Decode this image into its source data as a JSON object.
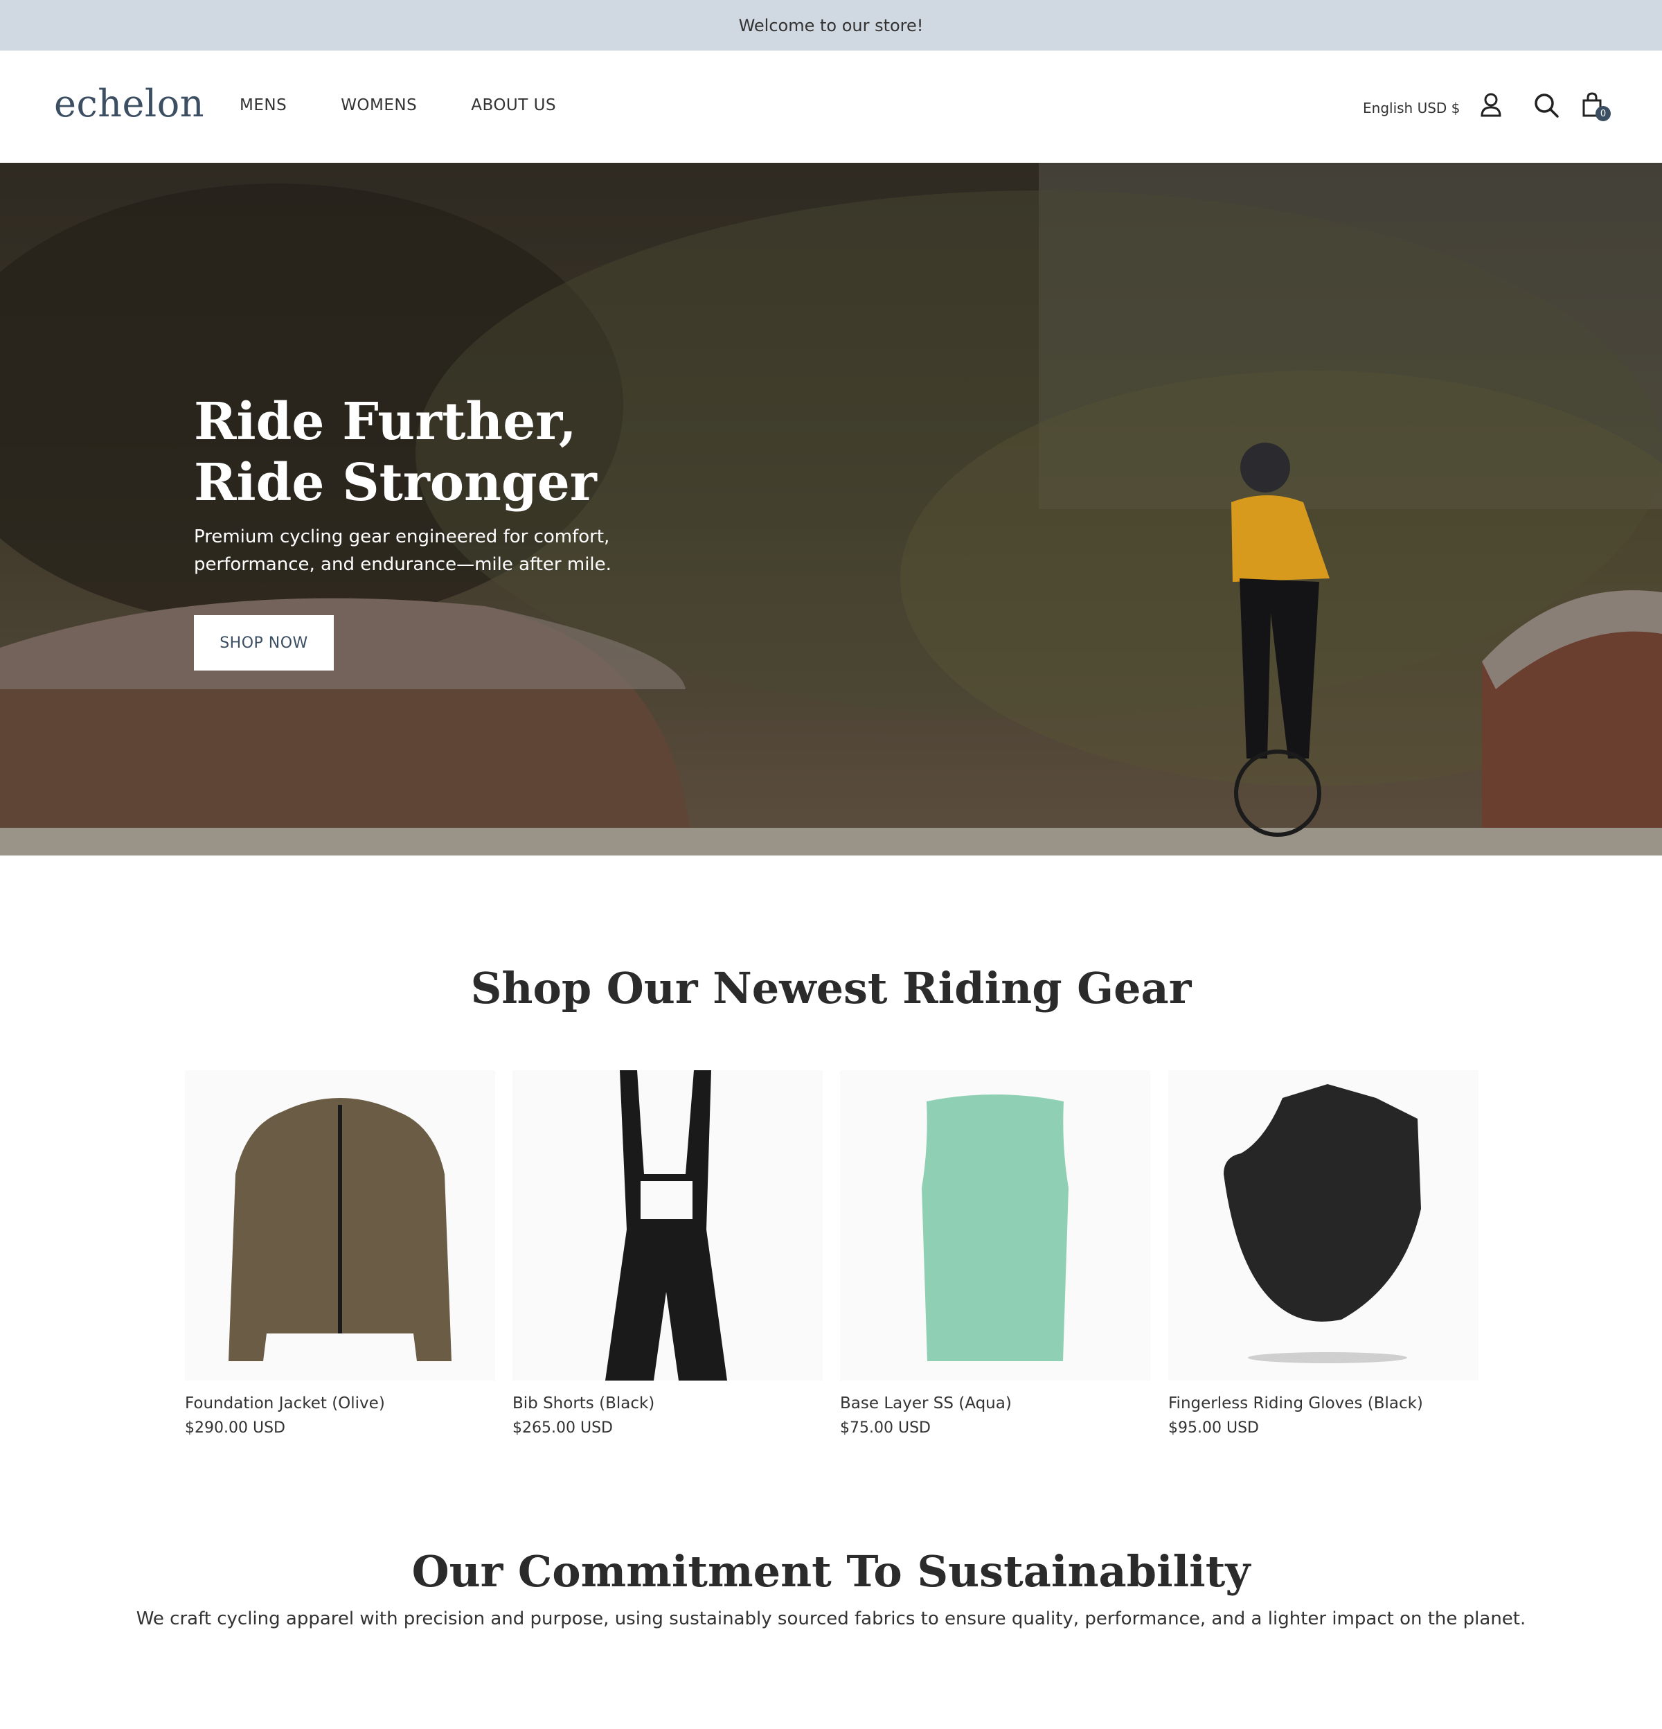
{
  "announcement": {
    "text": "Welcome to our store!"
  },
  "header": {
    "logo": "echelon",
    "nav": [
      "MENS",
      "WOMENS",
      "ABOUT US"
    ],
    "locale": "English USD $",
    "icons": [
      "account-icon",
      "search-icon",
      "cart-icon"
    ],
    "cart_count": "0"
  },
  "hero": {
    "title": "Ride Further, Ride Stronger",
    "subtitle": "Premium cycling gear engineered for comfort, performance, and endurance—mile after mile.",
    "button": "SHOP NOW"
  },
  "products_section": {
    "title": "Shop Our Newest Riding Gear",
    "items": [
      {
        "name": "Foundation Jacket (Olive)",
        "price": "$290.00 USD",
        "color": "#6b5d45"
      },
      {
        "name": "Bib Shorts (Black)",
        "price": "$265.00 USD",
        "color": "#1a1a1a"
      },
      {
        "name": "Base Layer SS (Aqua)",
        "price": "$75.00 USD",
        "color": "#8fd0b4"
      },
      {
        "name": "Fingerless Riding Gloves (Black)",
        "price": "$95.00 USD",
        "color": "#262626"
      }
    ]
  },
  "commitment": {
    "title": "Our Commitment To Sustainability",
    "text": "We craft cycling apparel with precision and purpose, using sustainably sourced fabrics to ensure quality, performance, and a lighter impact on the planet."
  },
  "colors": {
    "accent": "#3c4e62",
    "announcement_bg": "#d0d8e1"
  }
}
